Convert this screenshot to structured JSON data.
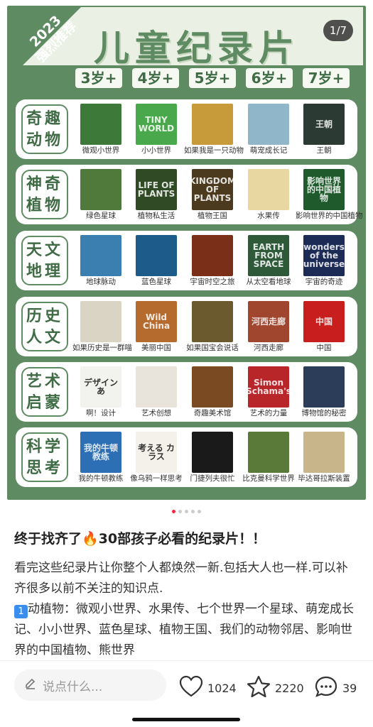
{
  "poster": {
    "corner_year": "2023",
    "corner_label": "强烈推荐",
    "title": "儿童纪录片",
    "page_indicator": "1/7",
    "ages": [
      "3岁+",
      "4岁+",
      "5岁+",
      "6岁+",
      "7岁+"
    ],
    "categories": [
      {
        "label_line1": "奇趣",
        "label_line2": "动物",
        "items": [
          {
            "caption": "微观小世界",
            "color": "#3d7a3a",
            "art": ""
          },
          {
            "caption": "小小世界",
            "color": "#4aa84c",
            "art": "TINY WORLD"
          },
          {
            "caption": "如果我是一只动物",
            "color": "#c79a3a",
            "art": ""
          },
          {
            "caption": "萌宠成长记",
            "color": "#8fb6c9",
            "art": ""
          },
          {
            "caption": "王朝",
            "color": "#2b3a33",
            "art": "王朝"
          }
        ]
      },
      {
        "label_line1": "神奇",
        "label_line2": "植物",
        "items": [
          {
            "caption": "绿色星球",
            "color": "#4f7a3b",
            "art": ""
          },
          {
            "caption": "植物私生活",
            "color": "#2f4a24",
            "art": "LIFE OF PLANTS"
          },
          {
            "caption": "植物王国",
            "color": "#4b3a1e",
            "art": "KINGDOM OF PLANTS"
          },
          {
            "caption": "水果传",
            "color": "#e9d7a2",
            "art": ""
          },
          {
            "caption": "影响世界的中国植物",
            "color": "#1f5a2c",
            "art": "影响世界的中国植物"
          }
        ]
      },
      {
        "label_line1": "天文",
        "label_line2": "地理",
        "items": [
          {
            "caption": "地球脉动",
            "color": "#3b7fb0",
            "art": ""
          },
          {
            "caption": "蓝色星球",
            "color": "#1c5b8a",
            "art": ""
          },
          {
            "caption": "宇宙时空之旅",
            "color": "#7a2f18",
            "art": ""
          },
          {
            "caption": "从太空看地球",
            "color": "#2e5a3a",
            "art": "EARTH FROM SPACE"
          },
          {
            "caption": "宇宙的奇迹",
            "color": "#1b2b55",
            "art": "wonders of the universe"
          }
        ]
      },
      {
        "label_line1": "历史",
        "label_line2": "人文",
        "items": [
          {
            "caption": "如果历史是一群喵",
            "color": "#d9d4c4",
            "art": ""
          },
          {
            "caption": "美丽中国",
            "color": "#b56a2e",
            "art": "Wild China"
          },
          {
            "caption": "如果国宝会说话",
            "color": "#6b5a2e",
            "art": ""
          },
          {
            "caption": "河西走廊",
            "color": "#a0452e",
            "art": "河西走廊"
          },
          {
            "caption": "中国",
            "color": "#c81e1e",
            "art": "中国"
          }
        ]
      },
      {
        "label_line1": "艺术",
        "label_line2": "启蒙",
        "items": [
          {
            "caption": "啊！设计",
            "color": "#f2f2ee",
            "art": "デザインあ"
          },
          {
            "caption": "艺术创想",
            "color": "#e8e4dc",
            "art": ""
          },
          {
            "caption": "奇趣美术馆",
            "color": "#7a4a22",
            "art": ""
          },
          {
            "caption": "艺术的力量",
            "color": "#b8262a",
            "art": "Simon Schama's"
          },
          {
            "caption": "博物馆的秘密",
            "color": "#2c3d5a",
            "art": ""
          }
        ]
      },
      {
        "label_line1": "科学",
        "label_line2": "思考",
        "items": [
          {
            "caption": "我的牛顿教练",
            "color": "#2d6fb5",
            "art": "我的牛顿教练"
          },
          {
            "caption": "像乌鸦一样思考",
            "color": "#f4f1ea",
            "art": "考える カラス"
          },
          {
            "caption": "门捷列夫很忙",
            "color": "#1a1a1a",
            "art": ""
          },
          {
            "caption": "比克曼科学世界",
            "color": "#5a7a3a",
            "art": ""
          },
          {
            "caption": "毕达哥拉斯装置",
            "color": "#c9b58a",
            "art": ""
          }
        ]
      }
    ]
  },
  "carousel": {
    "count": 5,
    "active": 0
  },
  "post": {
    "title": "终于找齐了🔥30部孩子必看的纪录片！！",
    "paragraph1": "看完这些纪录片让你整个人都焕然一新.包括大人也一样.可以补齐很多以前不关注的知识点.",
    "badge": "1",
    "paragraph2": "动植物：微观小世界、水果传、七个世界一个星球、萌宠成长记、小小世界、蓝色星球、植物王国、我们的动物邻居、影响世界的中国植物、熊世界"
  },
  "bottom_bar": {
    "comment_placeholder": "说点什么...",
    "likes": "1024",
    "favorites": "2220",
    "comments": "39"
  }
}
